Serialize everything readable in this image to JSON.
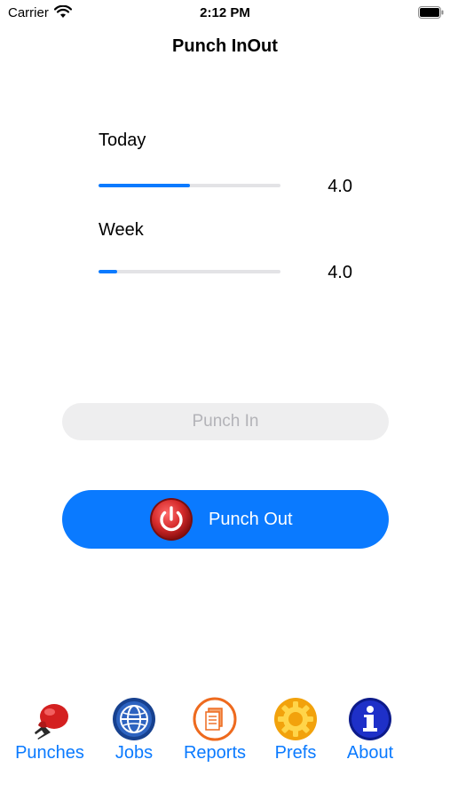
{
  "status_bar": {
    "carrier": "Carrier",
    "time": "2:12 PM"
  },
  "nav": {
    "title": "Punch InOut"
  },
  "stats": {
    "today": {
      "label": "Today",
      "value": "4.0",
      "progress": 0.5
    },
    "week": {
      "label": "Week",
      "value": "4.0",
      "progress": 0.1
    }
  },
  "buttons": {
    "punch_in": "Punch In",
    "punch_out": "Punch Out"
  },
  "tabs": [
    {
      "label": "Punches",
      "icon": "boxing-glove-icon"
    },
    {
      "label": "Jobs",
      "icon": "globe-icon"
    },
    {
      "label": "Reports",
      "icon": "document-icon"
    },
    {
      "label": "Prefs",
      "icon": "gear-icon"
    },
    {
      "label": "About",
      "icon": "info-icon"
    }
  ],
  "colors": {
    "accent": "#0a7aff",
    "power_red": "#d42a2a"
  }
}
